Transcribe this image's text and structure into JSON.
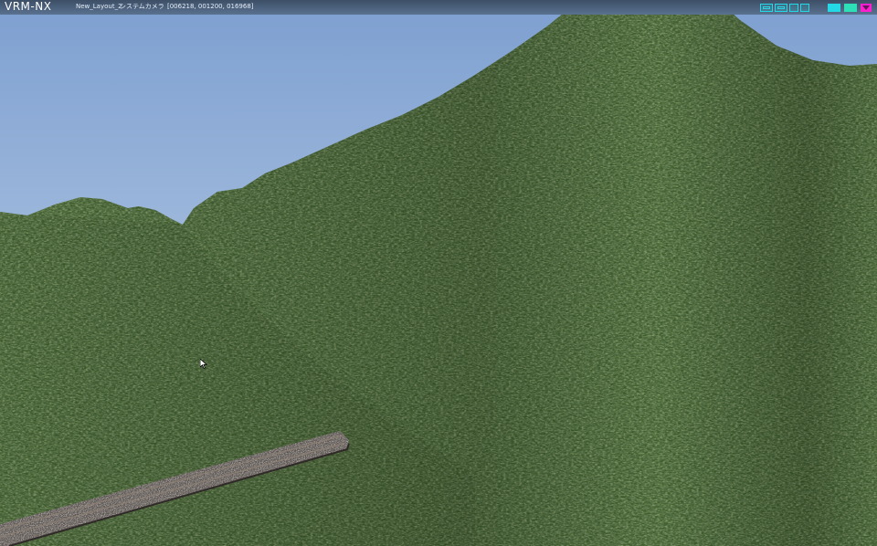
{
  "app": {
    "logo": "VRM-NX",
    "layout_name": "New_Layout_2",
    "camera_name": "システムカメラ",
    "camera_coords": "[006218, 001200, 016968]"
  },
  "toolbar": {
    "icons": [
      "camera-icon",
      "layout-view-icon",
      "frame-icon",
      "panel-icon",
      "window-icon",
      "active-mode-icon",
      "menu-dropdown-icon"
    ]
  },
  "scene": {
    "sky_top_color": "#7d9fd0",
    "sky_bottom_color": "#c8d8ea",
    "terrain_color": "#3c5a2c",
    "track_color": "#6e6560"
  }
}
